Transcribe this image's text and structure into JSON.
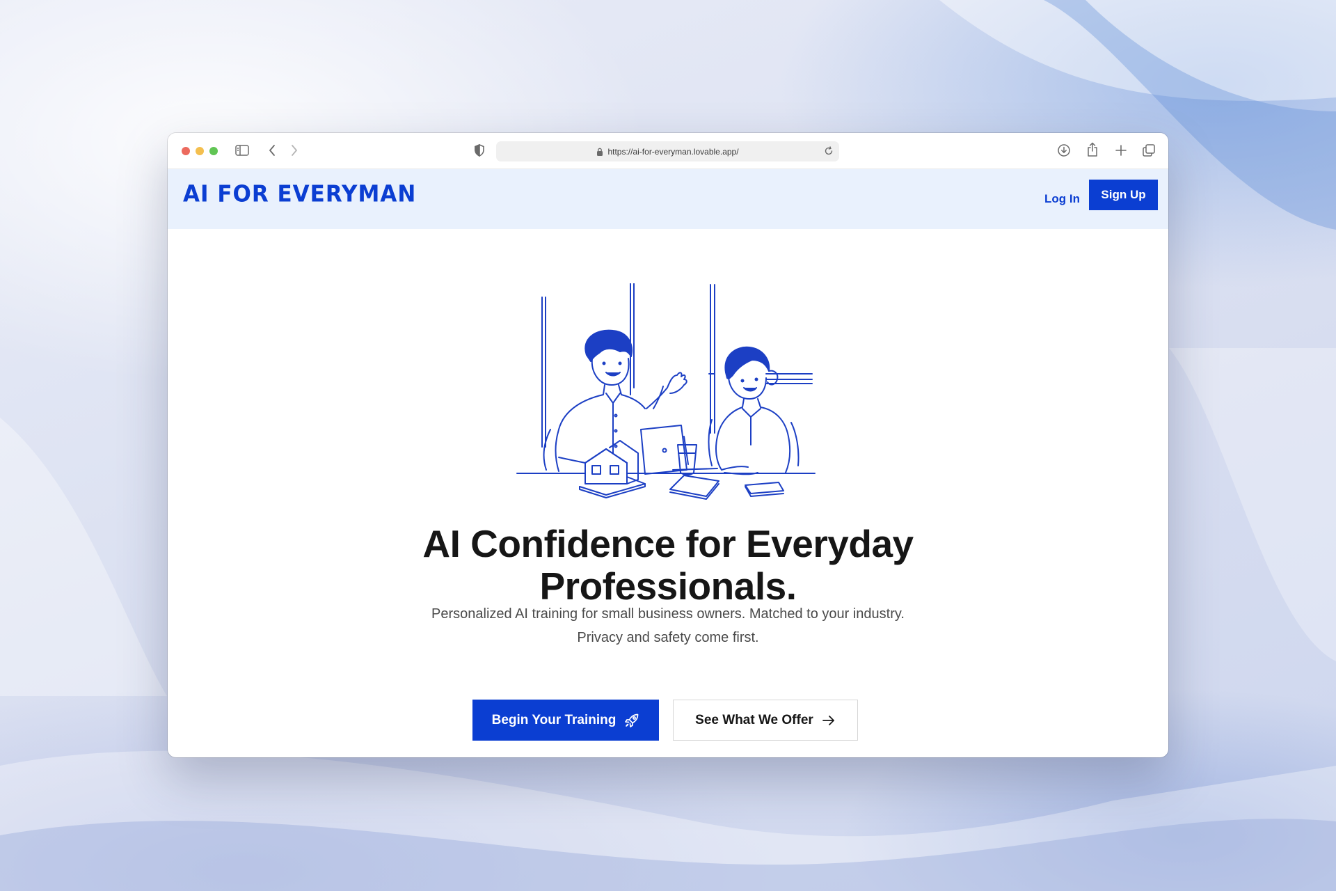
{
  "browser": {
    "url": "https://ai-for-everyman.lovable.app/"
  },
  "header": {
    "logo": "AI FOR EVERYMAN",
    "login_label": "Log In",
    "signup_label": "Sign Up"
  },
  "hero": {
    "headline_line1": "AI Confidence for Everyday",
    "headline_line2": "Professionals.",
    "subtitle_line1": "Personalized AI training for small business owners. Matched to your industry.",
    "subtitle_line2": "Privacy and safety come first.",
    "primary_cta": "Begin Your Training",
    "secondary_cta": "See What We Offer"
  },
  "colors": {
    "brand": "#0b3ed2",
    "header_bg": "#e9f1fd",
    "headline": "#161616"
  },
  "icons": {
    "primary_cta": "rocket-icon",
    "secondary_cta": "arrow-right-icon"
  }
}
